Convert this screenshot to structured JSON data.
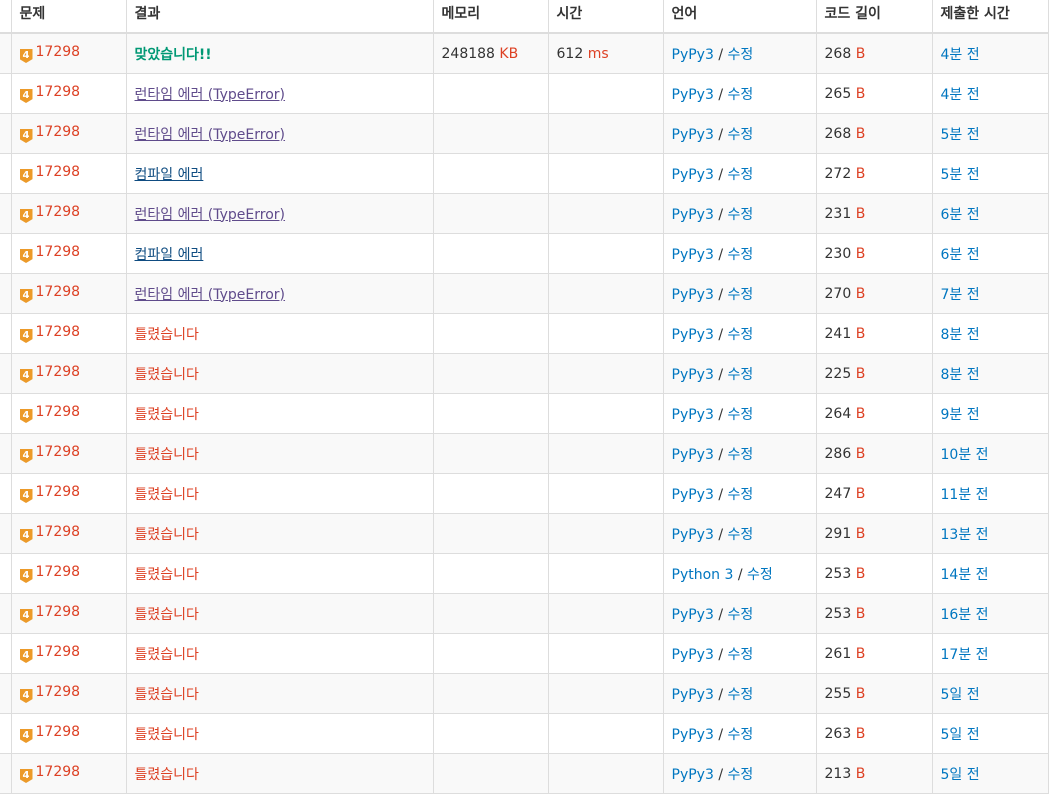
{
  "headers": {
    "problem": "문제",
    "result": "결과",
    "memory": "메모리",
    "time": "시간",
    "language": "언어",
    "code_length": "코드 길이",
    "submitted_time": "제출한 시간"
  },
  "badge_level": "4",
  "units": {
    "memory": "KB",
    "time": "ms",
    "length": "B"
  },
  "edit_label": "수정",
  "colors": {
    "accepted": "#009874",
    "runtime_error": "#5f4b8b",
    "compile_error": "#0f4c81",
    "wrong_answer": "#dd4124",
    "link": "#0076c0",
    "badge": "#ec9a29"
  },
  "rows": [
    {
      "problem": "17298",
      "result": "맞았습니다!!",
      "result_type": "ac",
      "memory": "248188",
      "time": "612",
      "language": "PyPy3",
      "length": "268",
      "submitted": "4분 전"
    },
    {
      "problem": "17298",
      "result": "런타임 에러 (TypeError)",
      "result_type": "rte",
      "memory": "",
      "time": "",
      "language": "PyPy3",
      "length": "265",
      "submitted": "4분 전"
    },
    {
      "problem": "17298",
      "result": "런타임 에러 (TypeError)",
      "result_type": "rte",
      "memory": "",
      "time": "",
      "language": "PyPy3",
      "length": "268",
      "submitted": "5분 전"
    },
    {
      "problem": "17298",
      "result": "컴파일 에러",
      "result_type": "ce",
      "memory": "",
      "time": "",
      "language": "PyPy3",
      "length": "272",
      "submitted": "5분 전"
    },
    {
      "problem": "17298",
      "result": "런타임 에러 (TypeError)",
      "result_type": "rte",
      "memory": "",
      "time": "",
      "language": "PyPy3",
      "length": "231",
      "submitted": "6분 전"
    },
    {
      "problem": "17298",
      "result": "컴파일 에러",
      "result_type": "ce",
      "memory": "",
      "time": "",
      "language": "PyPy3",
      "length": "230",
      "submitted": "6분 전"
    },
    {
      "problem": "17298",
      "result": "런타임 에러 (TypeError)",
      "result_type": "rte",
      "memory": "",
      "time": "",
      "language": "PyPy3",
      "length": "270",
      "submitted": "7분 전"
    },
    {
      "problem": "17298",
      "result": "틀렸습니다",
      "result_type": "wa",
      "memory": "",
      "time": "",
      "language": "PyPy3",
      "length": "241",
      "submitted": "8분 전"
    },
    {
      "problem": "17298",
      "result": "틀렸습니다",
      "result_type": "wa",
      "memory": "",
      "time": "",
      "language": "PyPy3",
      "length": "225",
      "submitted": "8분 전"
    },
    {
      "problem": "17298",
      "result": "틀렸습니다",
      "result_type": "wa",
      "memory": "",
      "time": "",
      "language": "PyPy3",
      "length": "264",
      "submitted": "9분 전"
    },
    {
      "problem": "17298",
      "result": "틀렸습니다",
      "result_type": "wa",
      "memory": "",
      "time": "",
      "language": "PyPy3",
      "length": "286",
      "submitted": "10분 전"
    },
    {
      "problem": "17298",
      "result": "틀렸습니다",
      "result_type": "wa",
      "memory": "",
      "time": "",
      "language": "PyPy3",
      "length": "247",
      "submitted": "11분 전"
    },
    {
      "problem": "17298",
      "result": "틀렸습니다",
      "result_type": "wa",
      "memory": "",
      "time": "",
      "language": "PyPy3",
      "length": "291",
      "submitted": "13분 전"
    },
    {
      "problem": "17298",
      "result": "틀렸습니다",
      "result_type": "wa",
      "memory": "",
      "time": "",
      "language": "Python 3",
      "length": "253",
      "submitted": "14분 전"
    },
    {
      "problem": "17298",
      "result": "틀렸습니다",
      "result_type": "wa",
      "memory": "",
      "time": "",
      "language": "PyPy3",
      "length": "253",
      "submitted": "16분 전"
    },
    {
      "problem": "17298",
      "result": "틀렸습니다",
      "result_type": "wa",
      "memory": "",
      "time": "",
      "language": "PyPy3",
      "length": "261",
      "submitted": "17분 전"
    },
    {
      "problem": "17298",
      "result": "틀렸습니다",
      "result_type": "wa",
      "memory": "",
      "time": "",
      "language": "PyPy3",
      "length": "255",
      "submitted": "5일 전"
    },
    {
      "problem": "17298",
      "result": "틀렸습니다",
      "result_type": "wa",
      "memory": "",
      "time": "",
      "language": "PyPy3",
      "length": "263",
      "submitted": "5일 전"
    },
    {
      "problem": "17298",
      "result": "틀렸습니다",
      "result_type": "wa",
      "memory": "",
      "time": "",
      "language": "PyPy3",
      "length": "213",
      "submitted": "5일 전"
    }
  ]
}
